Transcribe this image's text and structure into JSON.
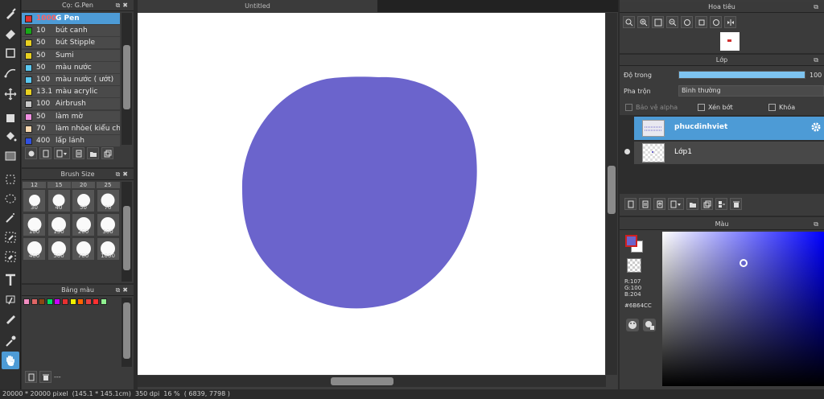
{
  "window": {
    "document_tab": "Untitled"
  },
  "brush_panel": {
    "title": "Cọ: G.Pen",
    "items": [
      {
        "size": "1000",
        "name": "G Pen",
        "color": "#e03030",
        "selected": true
      },
      {
        "size": "10",
        "name": "bút canh",
        "color": "#18a818"
      },
      {
        "size": "50",
        "name": "bút Stipple",
        "color": "#e8d020"
      },
      {
        "size": "50",
        "name": "Sumi",
        "color": "#e8d020"
      },
      {
        "size": "50",
        "name": "màu nước",
        "color": "#5ac8f0"
      },
      {
        "size": "100",
        "name": "màu nước ( ướt)",
        "color": "#5ac8f0"
      },
      {
        "size": "13.1",
        "name": "màu acrylic",
        "color": "#e8d020"
      },
      {
        "size": "100",
        "name": "Airbrush",
        "color": "#c8c8c8"
      },
      {
        "size": "50",
        "name": "làm mờ",
        "color": "#f090e0"
      },
      {
        "size": "70",
        "name": "làm nhòe( kiểu cha",
        "color": "#f8d8b0"
      },
      {
        "size": "400",
        "name": "lấp lánh",
        "color": "#3050e0"
      }
    ]
  },
  "brush_size_panel": {
    "title": "Brush Size",
    "top_labels": [
      "12",
      "15",
      "20",
      "25"
    ],
    "sizes": [
      "30",
      "40",
      "50",
      "70",
      "100",
      "150",
      "200",
      "300",
      "400",
      "500",
      "700",
      "1000"
    ]
  },
  "palette_panel": {
    "title": "Bảng màu",
    "swatches": [
      "#f08cc0",
      "#e06666",
      "#8b4513",
      "#00e060",
      "#c800ff",
      "#e83030",
      "#f0f000",
      "#ff6600",
      "#e84040",
      "#ff3030",
      "#90f090"
    ],
    "footer_text": "---"
  },
  "navigator_panel": {
    "title": "Hoa tiêu"
  },
  "layer_panel": {
    "title": "Lớp",
    "opacity_label": "Độ trong",
    "opacity_value": "100",
    "opacity": 1.0,
    "blend_label": "Pha trộn",
    "blend_value": "Bình thường",
    "protect_alpha": "Bảo vệ alpha",
    "clipping": "Xén bớt",
    "lock": "Khóa",
    "layers": [
      {
        "name": "phucdinhviet",
        "selected": true
      },
      {
        "name": "Lớp1",
        "selected": false
      }
    ]
  },
  "color_panel": {
    "title": "Màu",
    "rgb_r": "R:107",
    "rgb_g": "G:100",
    "rgb_b": "B:204",
    "hex": "#6B64CC"
  },
  "colors": {
    "accent": "#4d9bd6",
    "drawn_circle": "#6b64cc"
  },
  "status_bar": {
    "dimensions": "20000 * 20000 pixel",
    "physical": "(145.1 * 145.1cm)",
    "dpi": "350 dpi",
    "zoom": "16 %",
    "cursor": "( 6839, 7798 )"
  }
}
